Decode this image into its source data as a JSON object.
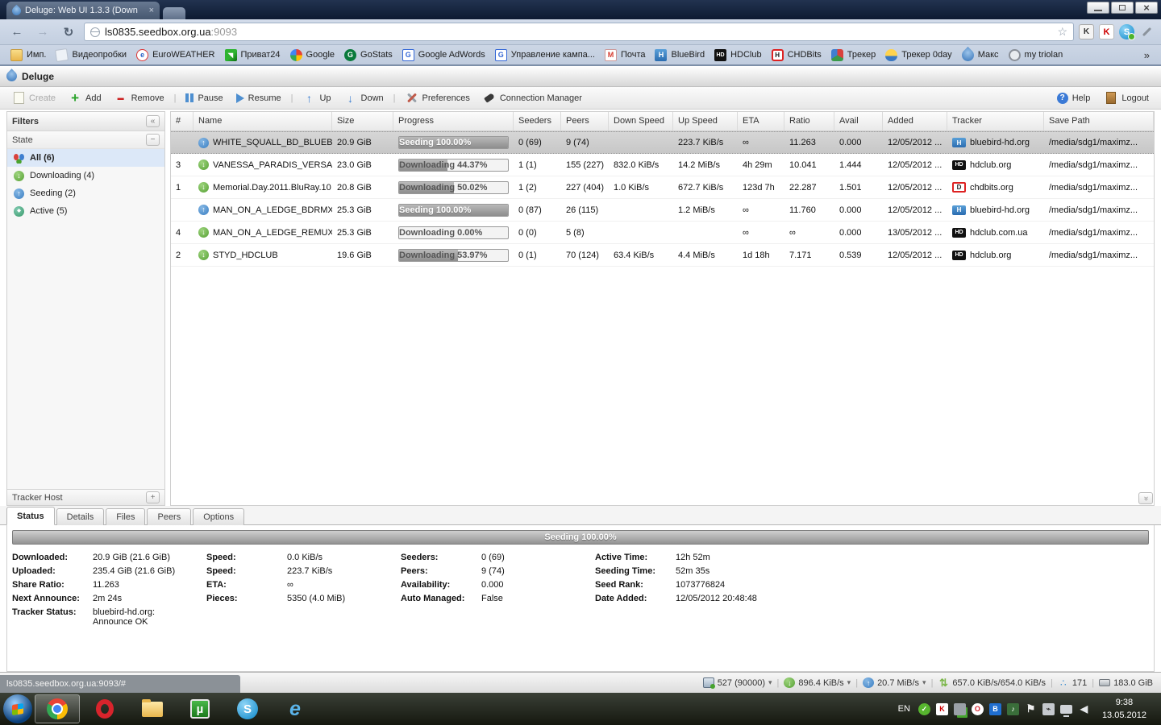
{
  "browser": {
    "tab_title": "Deluge: Web UI 1.3.3 (Down",
    "tab_close": "×",
    "window_controls": [
      "minimize",
      "maximize",
      "close"
    ],
    "nav": [
      "back",
      "forward",
      "reload"
    ],
    "url_host": "ls0835.seedbox.org.ua",
    "url_port": ":9093",
    "star": "☆",
    "bookmarks": [
      {
        "label": "Имп.",
        "icon": "folder"
      },
      {
        "label": "Видеопробки",
        "icon": "page"
      },
      {
        "label": "EuroWEATHER",
        "icon": "euroweather"
      },
      {
        "label": "Приват24",
        "icon": "privat24"
      },
      {
        "label": "Google",
        "icon": "google"
      },
      {
        "label": "GoStats",
        "icon": "gostats"
      },
      {
        "label": "Google AdWords",
        "icon": "adwords"
      },
      {
        "label": "Управление кампа...",
        "icon": "adwords"
      },
      {
        "label": "Почта",
        "icon": "mail"
      },
      {
        "label": "BlueBird",
        "icon": "bluebird"
      },
      {
        "label": "HDClub",
        "icon": "hdclub"
      },
      {
        "label": "CHDBits",
        "icon": "chdbits"
      },
      {
        "label": "Трекер",
        "icon": "tracker"
      },
      {
        "label": "Трекер 0day",
        "icon": "tracker0day"
      },
      {
        "label": "Макс",
        "icon": "drop"
      },
      {
        "label": "my triolan",
        "icon": "globe"
      }
    ],
    "bookmarks_overflow": "»",
    "status_tooltip": "ls0835.seedbox.org.ua:9093/#"
  },
  "app": {
    "title": "Deluge",
    "toolbar": {
      "buttons": [
        {
          "label": "Create",
          "icon": "create",
          "disabled": true
        },
        {
          "label": "Add",
          "icon": "add"
        },
        {
          "label": "Remove",
          "icon": "remove",
          "sep_after": true
        },
        {
          "label": "Pause",
          "icon": "pause"
        },
        {
          "label": "Resume",
          "icon": "resume",
          "sep_after": true
        },
        {
          "label": "Up",
          "icon": "up"
        },
        {
          "label": "Down",
          "icon": "down",
          "sep_after": true
        },
        {
          "label": "Preferences",
          "icon": "preferences"
        },
        {
          "label": "Connection Manager",
          "icon": "connection"
        }
      ],
      "help_label": "Help",
      "logout_label": "Logout"
    }
  },
  "filters": {
    "title": "Filters",
    "collapse_glyph": "«",
    "group_label": "State",
    "group_collapse_glyph": "−",
    "items": [
      {
        "label": "All (6)",
        "icon": "all",
        "selected": true
      },
      {
        "label": "Downloading (4)",
        "icon": "downloading"
      },
      {
        "label": "Seeding (2)",
        "icon": "seeding"
      },
      {
        "label": "Active (5)",
        "icon": "active"
      }
    ],
    "tracker_host_label": "Tracker Host",
    "expand_glyph": "+"
  },
  "table": {
    "columns": [
      "#",
      "Name",
      "Size",
      "Progress",
      "Seeders",
      "Peers",
      "Down Speed",
      "Up Speed",
      "ETA",
      "Ratio",
      "Avail",
      "Added",
      "Tracker",
      "Save Path"
    ],
    "rows": [
      {
        "num": "",
        "state": "seeding",
        "name": "WHITE_SQUALL_BD_BLUEBI",
        "size": "20.9 GiB",
        "progress_label": "Seeding 100.00%",
        "progress": 100,
        "seeders": "0 (69)",
        "peers": "9 (74)",
        "down": "",
        "up": "223.7 KiB/s",
        "eta": "∞",
        "ratio": "11.263",
        "avail": "0.000",
        "added": "12/05/2012 ...",
        "tracker": "bluebird-hd.org",
        "tracker_icon": "bluebird",
        "path": "/media/sdg1/maximz...",
        "selected": true
      },
      {
        "num": "3",
        "state": "downloading",
        "name": "VANESSA_PARADIS_VERSA",
        "size": "23.0 GiB",
        "progress_label": "Downloading 44.37%",
        "progress": 44.37,
        "seeders": "1 (1)",
        "peers": "155 (227)",
        "down": "832.0 KiB/s",
        "up": "14.2 MiB/s",
        "eta": "4h 29m",
        "ratio": "10.041",
        "avail": "1.444",
        "added": "12/05/2012 ...",
        "tracker": "hdclub.org",
        "tracker_icon": "hdclub",
        "path": "/media/sdg1/maximz..."
      },
      {
        "num": "1",
        "state": "downloading",
        "name": "Memorial.Day.2011.BluRay.10",
        "size": "20.8 GiB",
        "progress_label": "Downloading 50.02%",
        "progress": 50.02,
        "seeders": "1 (2)",
        "peers": "227 (404)",
        "down": "1.0 KiB/s",
        "up": "672.7 KiB/s",
        "eta": "123d 7h",
        "ratio": "22.287",
        "avail": "1.501",
        "added": "12/05/2012 ...",
        "tracker": "chdbits.org",
        "tracker_icon": "chdbits",
        "path": "/media/sdg1/maximz..."
      },
      {
        "num": "",
        "state": "seeding",
        "name": "MAN_ON_A_LEDGE_BDRMX",
        "size": "25.3 GiB",
        "progress_label": "Seeding 100.00%",
        "progress": 100,
        "seeders": "0 (87)",
        "peers": "26 (115)",
        "down": "",
        "up": "1.2 MiB/s",
        "eta": "∞",
        "ratio": "11.760",
        "avail": "0.000",
        "added": "12/05/2012 ...",
        "tracker": "bluebird-hd.org",
        "tracker_icon": "bluebird",
        "path": "/media/sdg1/maximz..."
      },
      {
        "num": "4",
        "state": "downloading",
        "name": "MAN_ON_A_LEDGE_REMUX",
        "size": "25.3 GiB",
        "progress_label": "Downloading 0.00%",
        "progress": 0,
        "seeders": "0 (0)",
        "peers": "5 (8)",
        "down": "",
        "up": "",
        "eta": "∞",
        "ratio": "∞",
        "avail": "0.000",
        "added": "13/05/2012 ...",
        "tracker": "hdclub.com.ua",
        "tracker_icon": "hdclub",
        "path": "/media/sdg1/maximz..."
      },
      {
        "num": "2",
        "state": "downloading",
        "name": "STYD_HDCLUB",
        "size": "19.6 GiB",
        "progress_label": "Downloading 53.97%",
        "progress": 53.97,
        "seeders": "0 (1)",
        "peers": "70 (124)",
        "down": "63.4 KiB/s",
        "up": "4.4 MiB/s",
        "eta": "1d 18h",
        "ratio": "7.171",
        "avail": "0.539",
        "added": "12/05/2012 ...",
        "tracker": "hdclub.org",
        "tracker_icon": "hdclub",
        "path": "/media/sdg1/maximz..."
      }
    ]
  },
  "bottom": {
    "tabs": [
      {
        "label": "Status",
        "active": true
      },
      {
        "label": "Details"
      },
      {
        "label": "Files"
      },
      {
        "label": "Peers"
      },
      {
        "label": "Options"
      }
    ],
    "progress_label": "Seeding 100.00%",
    "columns": [
      [
        {
          "label": "Downloaded:",
          "value": "20.9 GiB (21.6 GiB)"
        },
        {
          "label": "Uploaded:",
          "value": "235.4 GiB (21.6 GiB)"
        },
        {
          "label": "Share Ratio:",
          "value": "11.263"
        },
        {
          "label": "Next Announce:",
          "value": "2m 24s"
        },
        {
          "label": "Tracker Status:",
          "value": "bluebird-hd.org:\nAnnounce OK"
        }
      ],
      [
        {
          "label": "Speed:",
          "value": "0.0 KiB/s"
        },
        {
          "label": "Speed:",
          "value": "223.7 KiB/s"
        },
        {
          "label": "ETA:",
          "value": "∞"
        },
        {
          "label": "Pieces:",
          "value": "5350 (4.0 MiB)"
        }
      ],
      [
        {
          "label": "Seeders:",
          "value": "0 (69)"
        },
        {
          "label": "Peers:",
          "value": "9 (74)"
        },
        {
          "label": "Availability:",
          "value": "0.000"
        },
        {
          "label": "Auto Managed:",
          "value": "False"
        }
      ],
      [
        {
          "label": "Active Time:",
          "value": "12h 52m"
        },
        {
          "label": "Seeding Time:",
          "value": "52m 35s"
        },
        {
          "label": "Seed Rank:",
          "value": "1073776824"
        },
        {
          "label": "Date Added:",
          "value": "12/05/2012 20:48:48"
        }
      ]
    ]
  },
  "statusbar": {
    "items": [
      {
        "icon": "connections",
        "text": "527 (90000)",
        "dropdown": true
      },
      {
        "icon": "down",
        "text": "896.4 KiB/s",
        "dropdown": true
      },
      {
        "icon": "up",
        "text": "20.7 MiB/s",
        "dropdown": true
      },
      {
        "icon": "updown",
        "text": "657.0 KiB/s/654.0 KiB/s"
      },
      {
        "icon": "share",
        "text": "171"
      },
      {
        "icon": "disk",
        "text": "183.0 GiB"
      }
    ],
    "dropdown_glyph": "▾"
  },
  "taskbar": {
    "apps": [
      {
        "name": "chrome",
        "active": true
      },
      {
        "name": "opera"
      },
      {
        "name": "explorer"
      },
      {
        "name": "utorrent"
      },
      {
        "name": "skype"
      },
      {
        "name": "ie"
      }
    ],
    "language": "EN",
    "tray": [
      "check",
      "kaspersky",
      "usb",
      "opera",
      "bluetooth",
      "player",
      "flag",
      "power",
      "network",
      "volume"
    ],
    "clock_time": "9:38",
    "clock_date": "13.05.2012"
  }
}
